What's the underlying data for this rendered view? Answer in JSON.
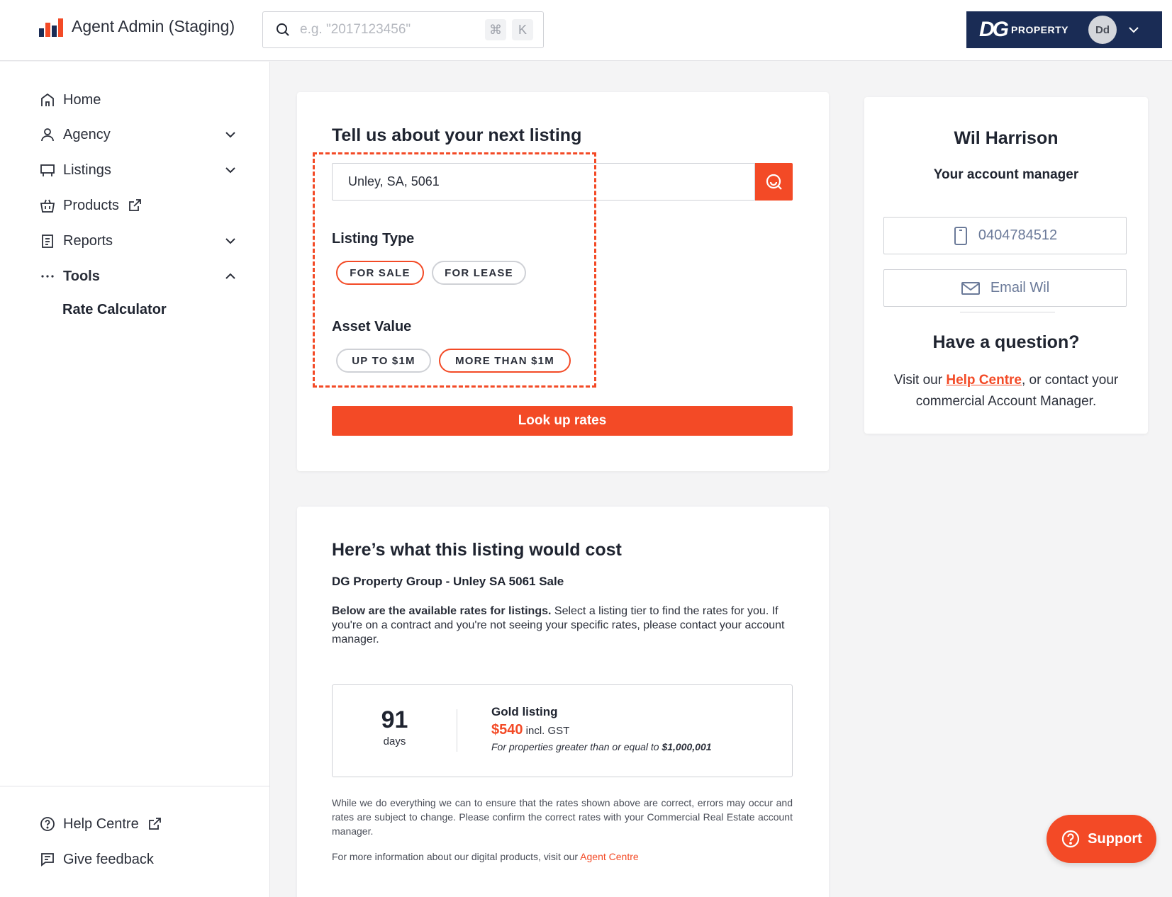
{
  "header": {
    "app_title": "Agent Admin (Staging)",
    "search_placeholder": "e.g. \"2017123456\"",
    "shortcut_key1": "⌘",
    "shortcut_key2": "K",
    "agency_logo_mark": "DG",
    "agency_logo_text": "PROPERTY",
    "avatar_initials": "Dd"
  },
  "sidebar": {
    "items": [
      {
        "label": "Home",
        "icon": "home-icon"
      },
      {
        "label": "Agency",
        "icon": "user-icon"
      },
      {
        "label": "Listings",
        "icon": "billboard-icon"
      },
      {
        "label": "Products",
        "icon": "basket-icon"
      },
      {
        "label": "Reports",
        "icon": "report-icon"
      },
      {
        "label": "Tools",
        "icon": "more-dots-icon"
      }
    ],
    "sub_item": "Rate Calculator",
    "bottom": [
      {
        "label": "Help Centre",
        "icon": "help-circle-icon"
      },
      {
        "label": "Give feedback",
        "icon": "feedback-icon"
      }
    ]
  },
  "listing_form": {
    "title": "Tell us about your next listing",
    "location_value": "Unley, SA, 5061",
    "listing_type_label": "Listing Type",
    "listing_type_options": [
      "FOR SALE",
      "FOR LEASE"
    ],
    "listing_type_selected": "FOR SALE",
    "asset_value_label": "Asset Value",
    "asset_value_options": [
      "UP TO $1M",
      "MORE THAN $1M"
    ],
    "asset_value_selected": "MORE THAN $1M",
    "submit_label": "Look up rates"
  },
  "pricing": {
    "title": "Here’s what this listing would cost",
    "subtitle": "DG Property Group - Unley SA 5061 Sale",
    "intro_bold": "Below are the available rates for listings.",
    "intro_rest": " Select a listing tier to find the rates for you. If you're on a contract and you're not seeing your specific rates, please contact your account manager.",
    "tier": {
      "days": "91",
      "days_unit": "days",
      "name": "Gold listing",
      "price": "$540",
      "price_suffix": "incl. GST",
      "note_prefix": "For properties greater than or equal to ",
      "note_value": "$1,000,001"
    },
    "disclaimer": "While we do everything we can to ensure that the rates shown above are correct, errors may occur and rates are subject to change. Please confirm the correct rates with your Commercial Real Estate account manager.",
    "more_info_prefix": "For more information about our digital products, visit our ",
    "more_info_link": "Agent Centre"
  },
  "account_manager": {
    "name": "Wil Harrison",
    "role": "Your account manager",
    "phone": "0404784512",
    "email_label": "Email Wil",
    "question_title": "Have a question?",
    "question_prefix": "Visit our ",
    "help_link": "Help Centre",
    "question_suffix": ", or contact your commercial Account Manager."
  },
  "support": {
    "label": "Support"
  },
  "colors": {
    "accent": "#f34a26",
    "navy": "#1a2c55",
    "link_muted": "#6b7a99"
  }
}
